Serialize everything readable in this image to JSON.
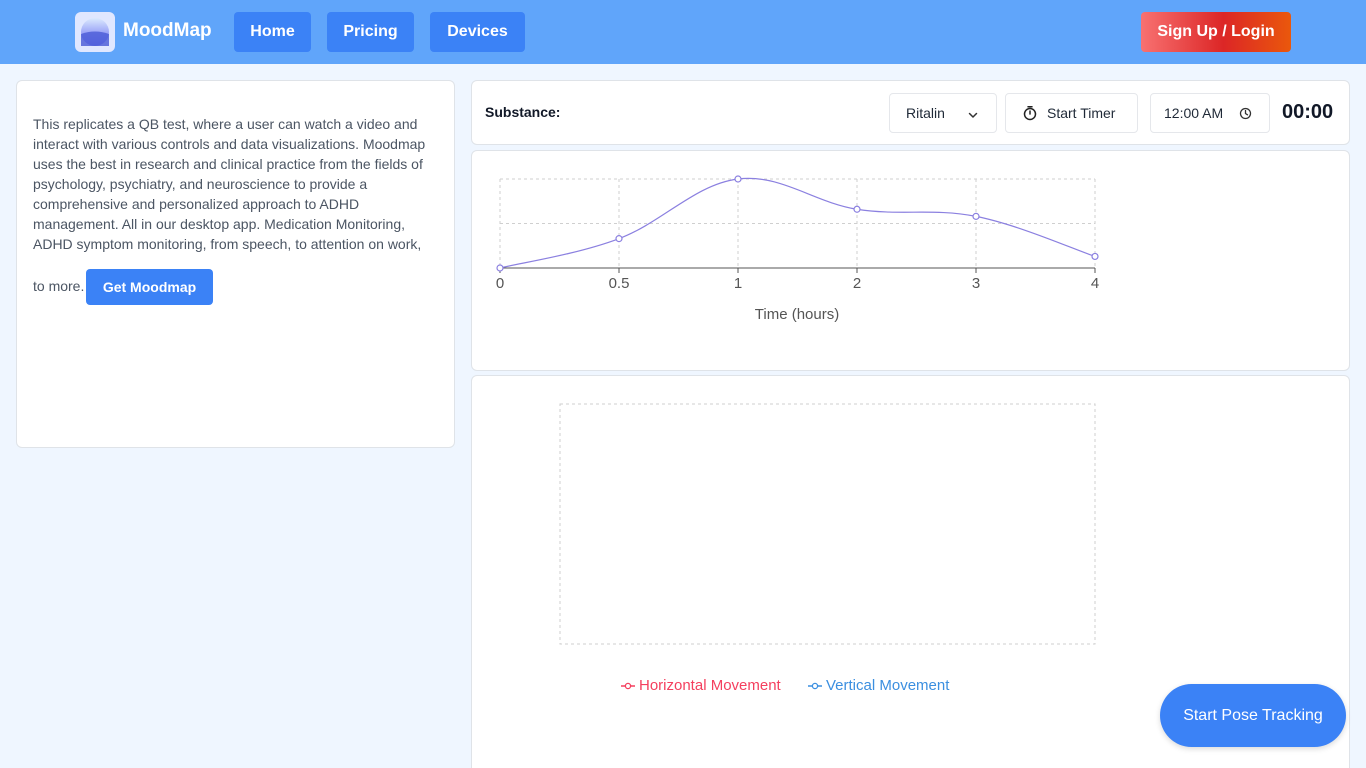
{
  "header": {
    "brand": "MoodMap",
    "nav": [
      {
        "label": "Home"
      },
      {
        "label": "Pricing"
      },
      {
        "label": "Devices"
      }
    ],
    "signup_label": "Sign Up / Login",
    "logo_icon": "moodmap-logo-icon"
  },
  "info": {
    "description": "This replicates a QB test, where a user can watch a video and interact with various controls and data visualizations. Moodmap uses the best in research and clinical practice from the fields of psychology, psychiatry, and neuroscience to provide a comprehensive and personalized approach to ADHD management. All in our desktop app. Medication Monitoring, ADHD symptom monitoring, from speech, to attention on work,",
    "tail": "to more.",
    "cta_label": "Get Moodmap"
  },
  "controls": {
    "substance_label": "Substance:",
    "substance_selected": "Ritalin",
    "substance_icon": "chevron-down-icon",
    "start_timer_label": "Start Timer",
    "start_timer_icon": "stopwatch-icon",
    "time_value": "12:00 AM",
    "time_icon": "clock-icon",
    "timer_display": "00:00"
  },
  "chart_data": [
    {
      "type": "line",
      "x": [
        0,
        0.5,
        1,
        2,
        3,
        4
      ],
      "xticks": [
        "0",
        "0.5",
        "1",
        "2",
        "3",
        "4"
      ],
      "values": [
        0,
        0.33,
        1.0,
        0.66,
        0.58,
        0.13
      ],
      "ylim": [
        0,
        1
      ],
      "xlabel": "Time (hours)",
      "ylabel": "",
      "grid": true,
      "line_color": "#8b80e0"
    },
    {
      "type": "line",
      "x": [],
      "series": [
        {
          "name": "Horizontal Movement",
          "values": [],
          "color": "#f43f5e"
        },
        {
          "name": "Vertical Movement",
          "values": [],
          "color": "#3b8fe0"
        }
      ],
      "legend": "bottom",
      "grid": true
    }
  ],
  "pose_button_label": "Start Pose Tracking"
}
